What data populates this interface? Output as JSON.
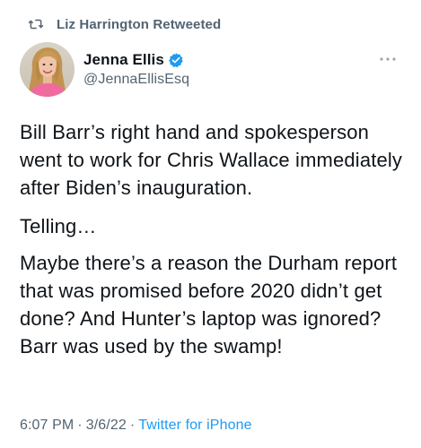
{
  "retweet": {
    "icon": "retweet-icon",
    "label": "Liz Harrington Retweeted"
  },
  "author": {
    "display_name": "Jenna Ellis",
    "handle": "@JennaEllisEsq",
    "verified": true,
    "verified_icon": "verified-badge-icon",
    "avatar_icon": "avatar"
  },
  "menu": {
    "icon": "more-options-icon"
  },
  "tweet": {
    "paragraphs": [
      "Bill Barr’s right hand and spokesperson went to work for Chris Wallace immediately after Biden’s inauguration.",
      "Telling…",
      "Maybe there’s a reason the Durham report that was promised before 2020 didn’t get done? And Hunter’s laptop was ignored? Barr was used by the swamp!"
    ]
  },
  "meta": {
    "time": "6:07 PM",
    "separator": "·",
    "date": "3/6/22",
    "source": "Twitter for iPhone"
  },
  "colors": {
    "text": "#0f1419",
    "secondary": "#536471",
    "accent": "#1d9bf0"
  }
}
